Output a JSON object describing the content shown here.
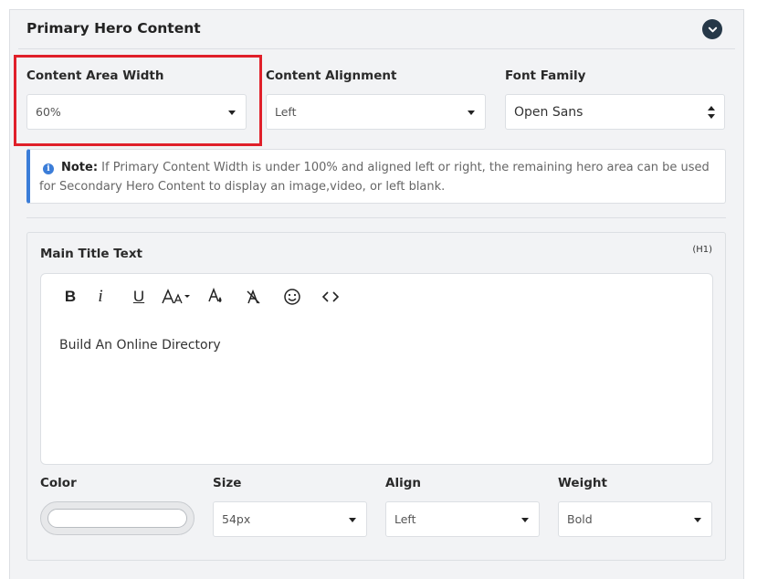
{
  "panel": {
    "title": "Primary Hero Content"
  },
  "layout_fields": {
    "width": {
      "label": "Content Area Width",
      "value": "60%"
    },
    "alignment": {
      "label": "Content Alignment",
      "value": "Left"
    },
    "font": {
      "label": "Font Family",
      "value": "Open Sans"
    }
  },
  "note": {
    "bold": "Note:",
    "text": " If Primary Content Width is under 100% and aligned left or right, the remaining hero area can be used for Secondary Hero Content to display an image,video, or left blank."
  },
  "title_section": {
    "label": "Main Title Text",
    "tag": "(H1)",
    "toolbar": {
      "bold": "B",
      "italic": "i",
      "underline": "U",
      "icons": [
        "font-size-icon",
        "text-color-icon",
        "clear-format-icon",
        "emoji-icon",
        "code-icon"
      ]
    },
    "content": "Build An Online Directory",
    "color_label": "Color",
    "size": {
      "label": "Size",
      "value": "54px"
    },
    "align": {
      "label": "Align",
      "value": "Left"
    },
    "weight": {
      "label": "Weight",
      "value": "Bold"
    }
  },
  "colors": {
    "highlight": "#e0202a",
    "accent": "#3b7dd8",
    "header_button": "#263848"
  }
}
